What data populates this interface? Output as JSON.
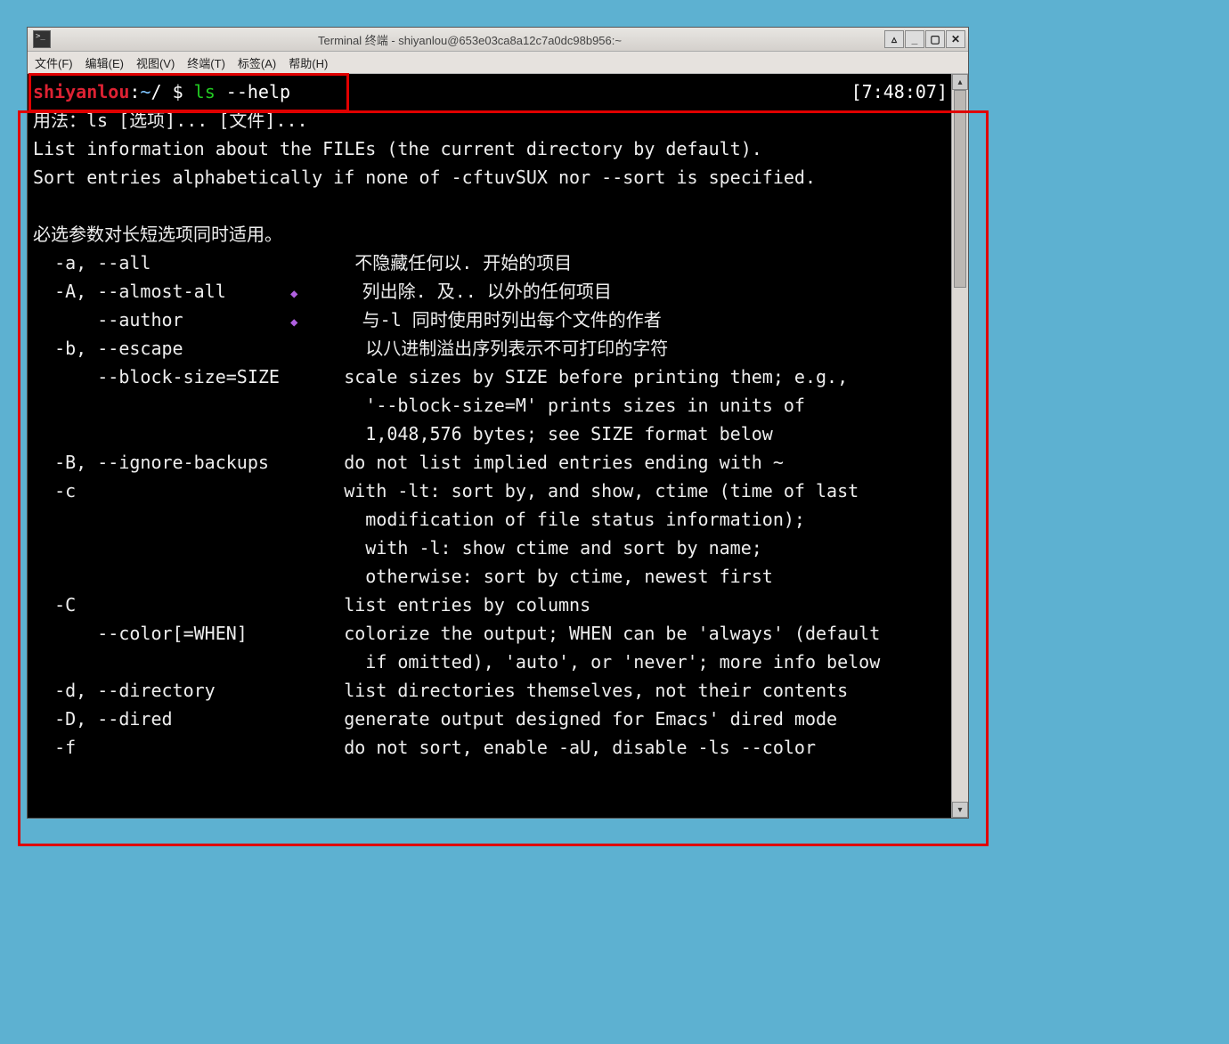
{
  "window": {
    "title": "Terminal 终端 - shiyanlou@653e03ca8a12c7a0dc98b956:~"
  },
  "controls": {
    "shade": "▵",
    "minimize": "_",
    "maximize": "▢",
    "close": "✕"
  },
  "menu": {
    "file": "文件(F)",
    "edit": "编辑(E)",
    "view": "视图(V)",
    "terminal": "终端(T)",
    "tabs": "标签(A)",
    "help": "帮助(H)"
  },
  "prompt": {
    "user": "shiyanlou",
    "sep": ":",
    "tilde": "~",
    "slash": "/ ",
    "dollar": "$ ",
    "cmd": "ls",
    "args": " --help",
    "clock": "[7:48:07]"
  },
  "out": {
    "l1": "用法：ls [选项]... [文件]...",
    "l2": "List information about the FILEs (the current directory by default).",
    "l3": "Sort entries alphabetically if none of -cftuvSUX nor --sort is specified.",
    "l4": "",
    "l5": "必选参数对长短选项同时适用。",
    "l6a": "  -a, --all             ",
    "l6d": "",
    "l6b": "      不隐藏任何以. 开始的项目",
    "l7a": "  -A, --almost-all      ",
    "l7d": "◆",
    "l7b": "      列出除. 及.. 以外的任何项目",
    "l8a": "      --author          ",
    "l8d": "◆",
    "l8b": "      与-l 同时使用时列出每个文件的作者",
    "l9": "  -b, --escape                 以八进制溢出序列表示不可打印的字符",
    "l10": "      --block-size=SIZE      scale sizes by SIZE before printing them; e.g.,",
    "l11": "                               '--block-size=M' prints sizes in units of",
    "l12": "                               1,048,576 bytes; see SIZE format below",
    "l13": "  -B, --ignore-backups       do not list implied entries ending with ~",
    "l14": "  -c                         with -lt: sort by, and show, ctime (time of last",
    "l15": "                               modification of file status information);",
    "l16": "                               with -l: show ctime and sort by name;",
    "l17": "                               otherwise: sort by ctime, newest first",
    "l18": "  -C                         list entries by columns",
    "l19": "      --color[=WHEN]         colorize the output; WHEN can be 'always' (default",
    "l20": "                               if omitted), 'auto', or 'never'; more info below",
    "l21": "  -d, --directory            list directories themselves, not their contents",
    "l22": "  -D, --dired                generate output designed for Emacs' dired mode",
    "l23": "  -f                         do not sort, enable -aU, disable -ls --color"
  }
}
